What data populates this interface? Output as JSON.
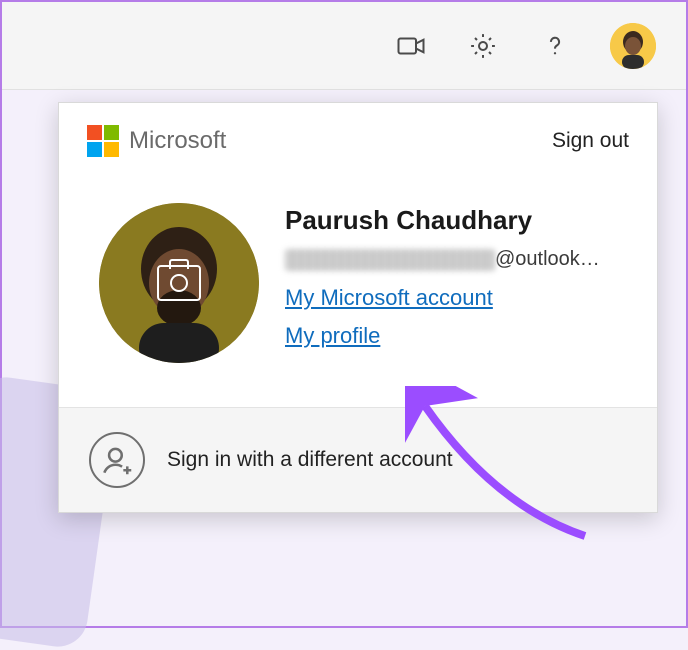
{
  "toolbar": {
    "icons": {
      "video": "video-icon",
      "settings": "gear-icon",
      "help": "help-icon",
      "avatar": "user-avatar"
    }
  },
  "card": {
    "brand": "Microsoft",
    "signout_label": "Sign out",
    "user": {
      "display_name": "Paurush Chaudhary",
      "email_domain": "@outlook…"
    },
    "links": {
      "my_account": "My Microsoft account",
      "my_profile": "My profile"
    },
    "footer": {
      "add_account_label": "Sign in with a different account"
    }
  }
}
